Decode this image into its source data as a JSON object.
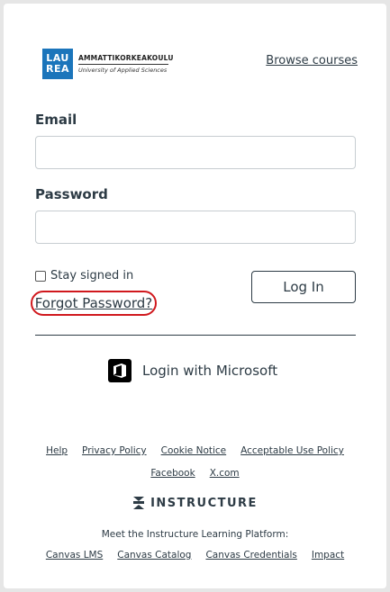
{
  "logo": {
    "box_line1": "LAU",
    "box_line2": "REA",
    "name": "AMMATTIKORKEAKOULU",
    "subtitle": "University of Applied Sciences",
    "brand_color": "#1b75bb"
  },
  "header": {
    "browse_courses": "Browse courses"
  },
  "form": {
    "email_label": "Email",
    "email_value": "",
    "password_label": "Password",
    "password_value": "",
    "stay_signed_in": "Stay signed in",
    "stay_signed_in_checked": false,
    "forgot_password": "Forgot Password?",
    "login_button": "Log In"
  },
  "sso": {
    "microsoft_label": "Login with Microsoft",
    "icon": "office-icon"
  },
  "footer": {
    "links_row1": [
      "Help",
      "Privacy Policy",
      "Cookie Notice",
      "Acceptable Use Policy"
    ],
    "links_row2": [
      "Facebook",
      "X.com"
    ],
    "brand": "INSTRUCTURE",
    "meet_text": "Meet the Instructure Learning Platform:",
    "platform_links": [
      "Canvas LMS",
      "Canvas Catalog",
      "Canvas Credentials",
      "Impact"
    ]
  },
  "colors": {
    "highlight": "#d0181d",
    "text": "#2d3b45",
    "background": "#e6e6e6"
  }
}
